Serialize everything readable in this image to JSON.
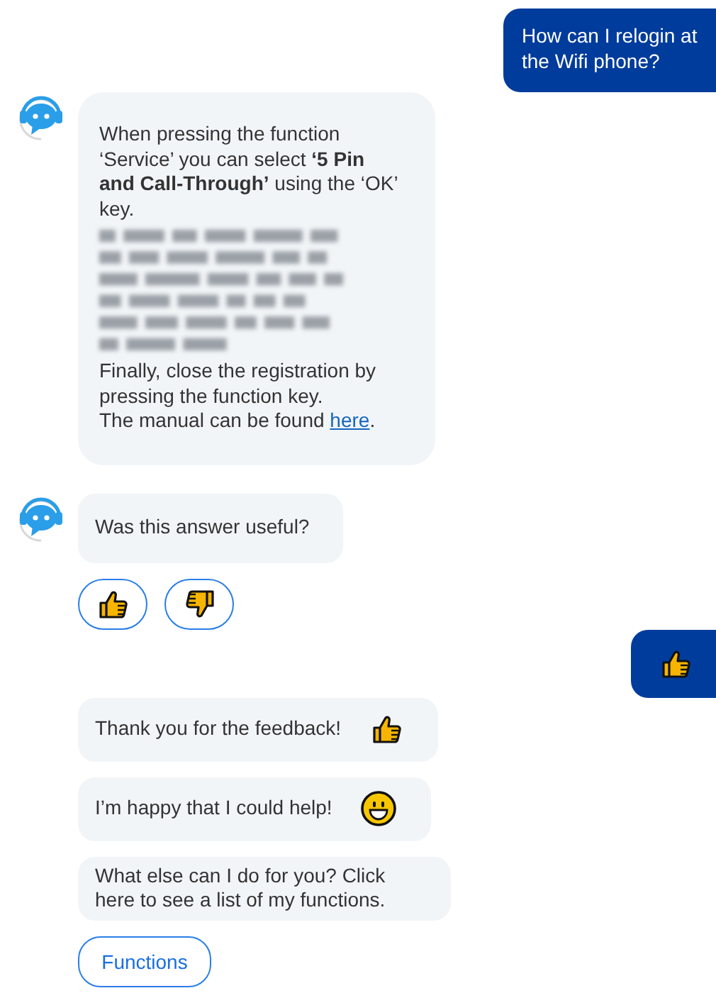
{
  "conversation": [
    {
      "kind": "user_message",
      "parts": [
        {
          "kind": "text",
          "text": "How can I relogin at the Wifi phone?"
        }
      ]
    },
    {
      "kind": "bot_message",
      "avatar": true,
      "parts": [
        {
          "kind": "text",
          "text": "When pressing the function ‘Service’ you can select **‘5 Pin and Call-Through’** using the ‘OK’ key."
        },
        {
          "kind": "redacted"
        },
        {
          "kind": "text",
          "text": "Finally, close the registration by pressing the function key."
        },
        {
          "kind": "link_text",
          "text": "The manual can be found ",
          "link": "here",
          "after": "."
        }
      ]
    },
    {
      "kind": "bot_message",
      "avatar": true,
      "parts": [
        {
          "kind": "text",
          "text": "Was this answer useful?"
        }
      ]
    },
    {
      "kind": "reactions",
      "buttons": [
        {
          "kind": "thumbs_up"
        },
        {
          "kind": "thumbs_down"
        }
      ]
    },
    {
      "kind": "user_message",
      "parts": [
        {
          "kind": "thumbs_up"
        }
      ]
    },
    {
      "kind": "bot_message",
      "avatar": false,
      "parts": [
        {
          "kind": "text",
          "text": "Thank you for the feedback!"
        },
        {
          "kind": "thumbs_up"
        }
      ]
    },
    {
      "kind": "bot_message",
      "avatar": false,
      "parts": [
        {
          "kind": "text",
          "text": "I’m happy that I could help!"
        },
        {
          "kind": "smiley"
        }
      ]
    },
    {
      "kind": "bot_message",
      "avatar": false,
      "parts": [
        {
          "kind": "text",
          "text": "What else can I do for you? Click here to see a list of my functions."
        }
      ]
    },
    {
      "kind": "button",
      "label": "Functions"
    }
  ]
}
